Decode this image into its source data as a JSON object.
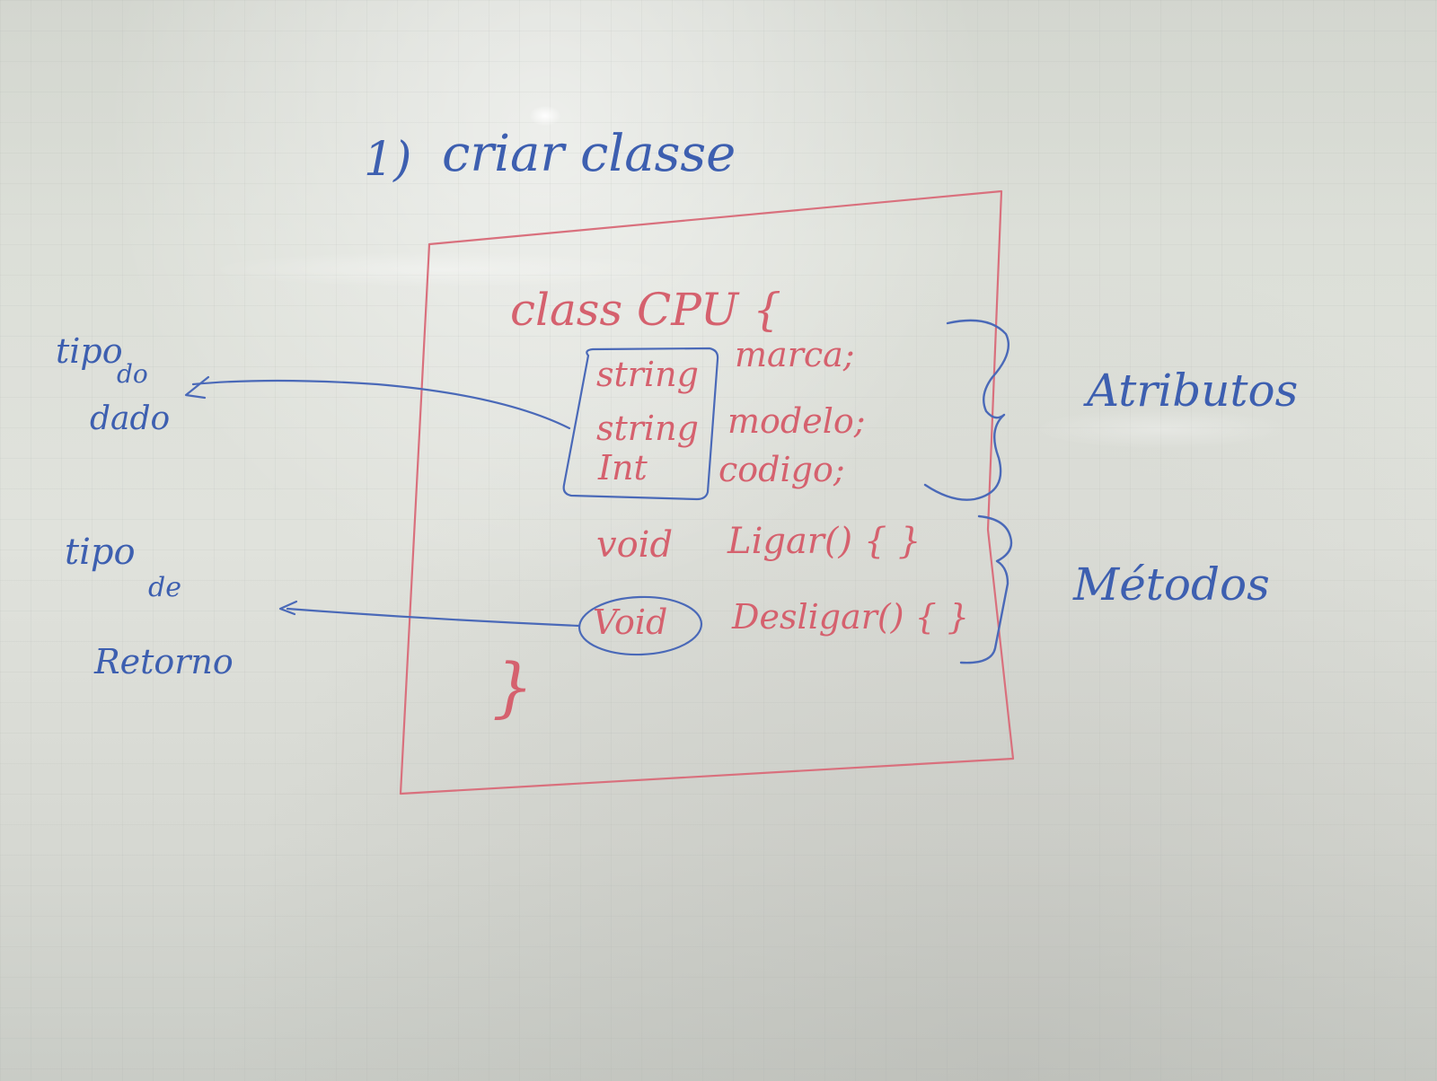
{
  "whiteboard": {
    "heading_number": "1)",
    "heading_text": "criar classe",
    "class_declaration": "class CPU {",
    "attributes": [
      {
        "type": "string",
        "name": "marca;"
      },
      {
        "type": "string",
        "name": "modelo;"
      },
      {
        "type": "Int",
        "name": "codigo;"
      }
    ],
    "methods": [
      {
        "return_type": "void",
        "signature": "Ligar() { }"
      },
      {
        "return_type": "Void",
        "signature": "Desligar() { }"
      }
    ],
    "closing_brace": "}",
    "label_attributes": "Atributos",
    "label_methods": "Métodos",
    "annotation_data_type": [
      "tipo",
      "do",
      "dado"
    ],
    "annotation_return_type": [
      "tipo",
      "de",
      "Retorno"
    ],
    "colors": {
      "blue_marker": "#3d5fb0",
      "red_marker": "#d5616e",
      "board": "#dcdfd8"
    }
  }
}
